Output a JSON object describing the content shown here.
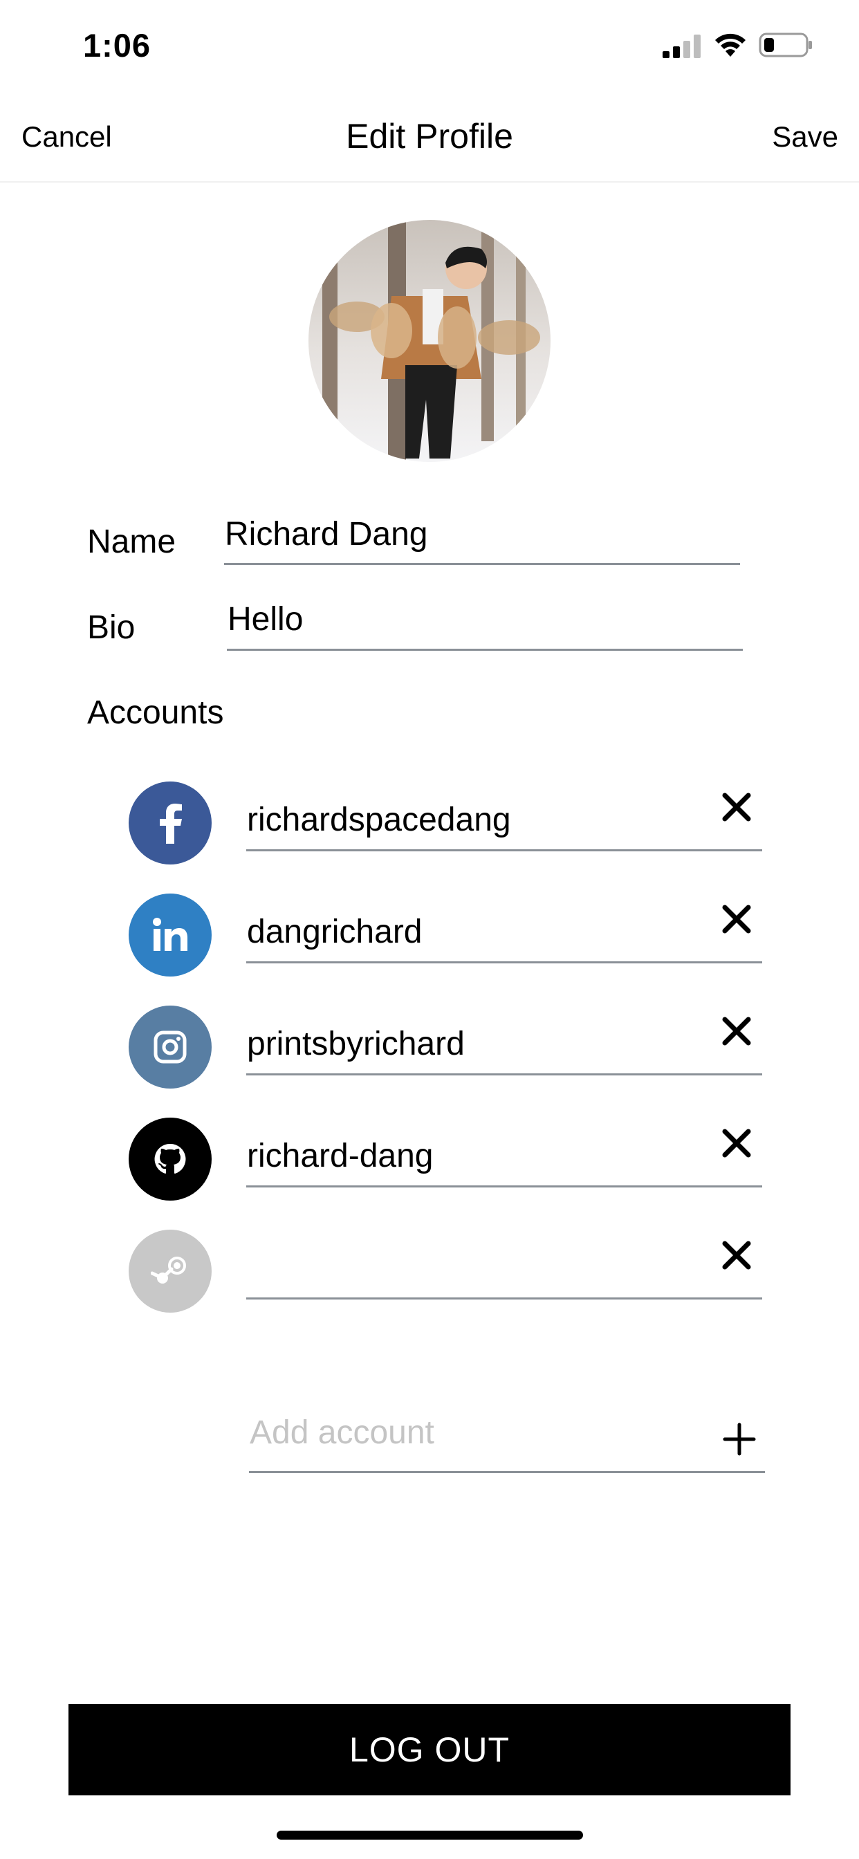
{
  "status_bar": {
    "time": "1:06",
    "signal_icon": "cellular-signal-icon",
    "wifi_icon": "wifi-icon",
    "battery_icon": "battery-low-icon"
  },
  "nav": {
    "cancel_label": "Cancel",
    "title": "Edit Profile",
    "save_label": "Save"
  },
  "profile": {
    "avatar_icon": "profile-photo",
    "name_label": "Name",
    "name_value": "Richard Dang",
    "bio_label": "Bio",
    "bio_value": "Hello",
    "accounts_label": "Accounts"
  },
  "accounts": [
    {
      "service": "facebook",
      "icon": "facebook-icon",
      "color": "#3b5998",
      "username": "richardspacedang"
    },
    {
      "service": "linkedin",
      "icon": "linkedin-icon",
      "color": "#2f80c4",
      "username": "dangrichard"
    },
    {
      "service": "instagram",
      "icon": "instagram-icon",
      "color": "#587ea3",
      "username": "printsbyrichard"
    },
    {
      "service": "github",
      "icon": "github-icon",
      "color": "#000000",
      "username": "richard-dang"
    },
    {
      "service": "steam",
      "icon": "steam-icon",
      "color": "#c8c8c8",
      "username": ""
    }
  ],
  "add_account": {
    "placeholder": "Add account",
    "icon": "plus-icon"
  },
  "logout_label": "LOG OUT"
}
